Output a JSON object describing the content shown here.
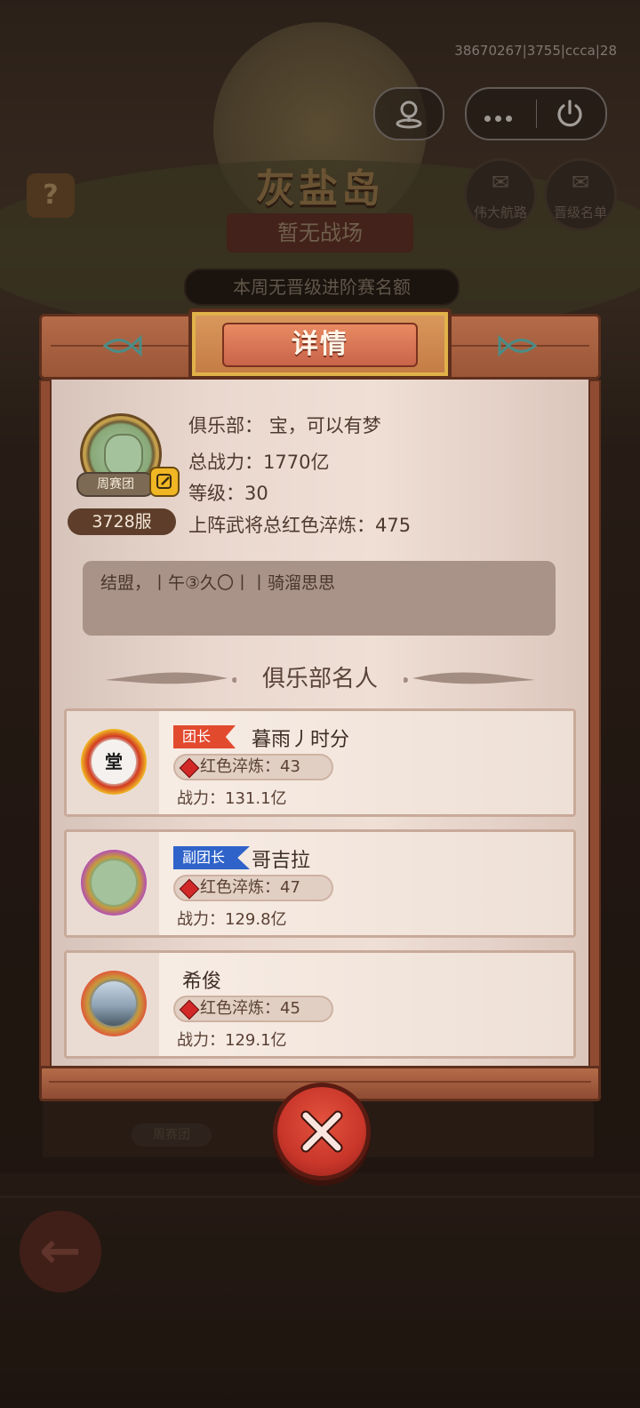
{
  "status": {
    "session_id": "38670267|3755|ccca|28"
  },
  "background": {
    "island_title": "灰盐岛",
    "battlefield_status": "暂无战场",
    "quota_notice": "本周无晋级进阶赛名额",
    "help_glyph": "?",
    "buttons": [
      {
        "label": "伟大航路",
        "icon": "scroll-icon"
      },
      {
        "label": "晋级名单",
        "icon": "scroll-icon"
      }
    ],
    "back_icon": "back-arrow-icon"
  },
  "modal": {
    "title": "详情",
    "club": {
      "name_label": "俱乐部：",
      "name_value": "宝，可以有梦",
      "power_label": "总战力：",
      "power_value": "1770亿",
      "level_label": "等级：",
      "level_value": "30",
      "refine_label": "上阵武将总红色淬炼：",
      "refine_value": "475",
      "server": "3728服",
      "avatar_tag": "周赛团",
      "notice": "结盟，丨午③久〇丨丨骑溜思思"
    },
    "famous_heading": "俱乐部名人",
    "members": [
      {
        "role": "团长",
        "role_color": "#e24a2e",
        "name": "暮雨丿时分",
        "refine_label": "红色淬炼：",
        "refine_value": "43",
        "power_label": "战力：",
        "power_value": "131.1亿",
        "avatar_text": "堂"
      },
      {
        "role": "副团长",
        "role_color": "#2f63c9",
        "name": "哥吉拉",
        "refine_label": "红色淬炼：",
        "refine_value": "47",
        "power_label": "战力：",
        "power_value": "129.8亿",
        "avatar_text": ""
      },
      {
        "role": "",
        "role_color": "",
        "name": "希俊",
        "refine_label": "红色淬炼：",
        "refine_value": "45",
        "power_label": "战力：",
        "power_value": "129.1亿",
        "avatar_text": ""
      }
    ],
    "close_icon": "close-x-icon"
  },
  "colors": {
    "accent_red": "#c9362a",
    "paper": "#efdfd5",
    "wood": "#b46b49"
  }
}
